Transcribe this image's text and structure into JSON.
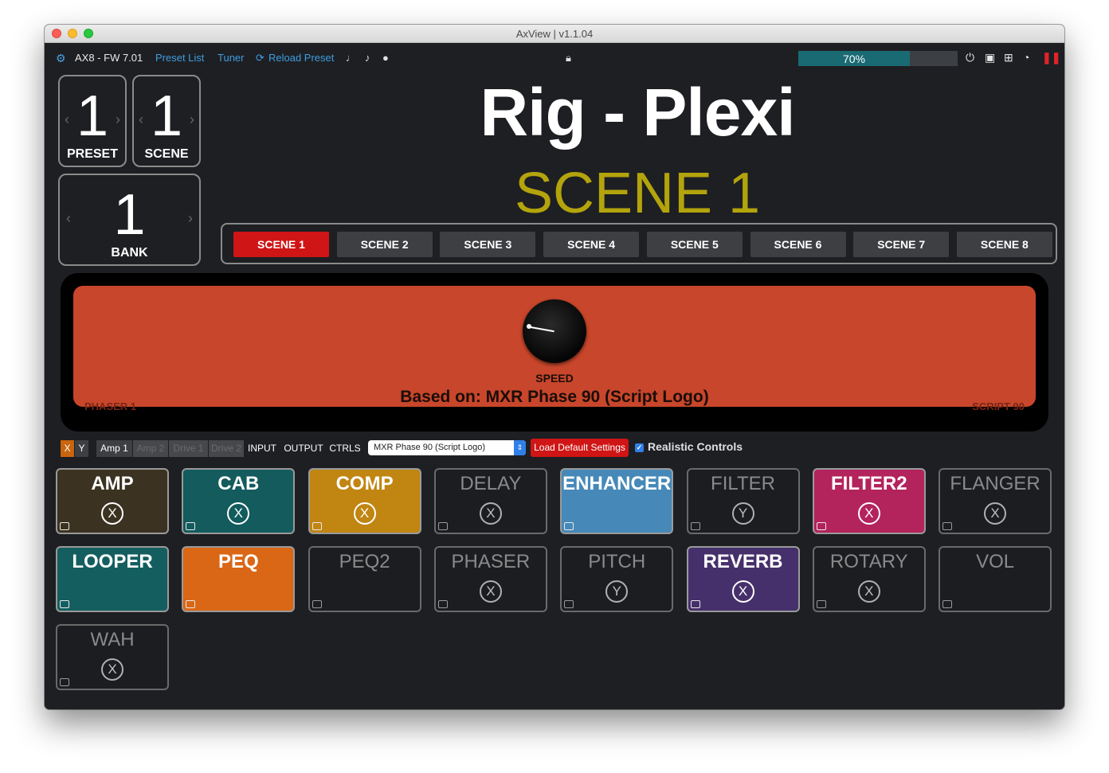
{
  "window": {
    "title": "AxView | v1.1.04"
  },
  "toolbar": {
    "device": "AX8 - FW 7.01",
    "preset_list": "Preset List",
    "tuner": "Tuner",
    "reload": "Reload Preset",
    "progress_label": "70%",
    "progress_value": 0.7
  },
  "counters": {
    "preset": {
      "value": "1",
      "label": "PRESET"
    },
    "scene": {
      "value": "1",
      "label": "SCENE"
    },
    "bank": {
      "value": "1",
      "label": "BANK"
    }
  },
  "rig_name": "Rig - Plexi",
  "scene_name": "SCENE 1",
  "scenes": [
    "SCENE 1",
    "SCENE 2",
    "SCENE 3",
    "SCENE 4",
    "SCENE 5",
    "SCENE 6",
    "SCENE 7",
    "SCENE 8"
  ],
  "active_scene": 0,
  "effect": {
    "knob_label": "SPEED",
    "based_on": "Based on: MXR Phase 90 (Script Logo)",
    "block_name": "PHASER 1",
    "model_name": "SCRIPT 90",
    "color": "#c8462b"
  },
  "controls": {
    "x": "X",
    "y": "Y",
    "tabs": [
      "Amp 1",
      "Amp 2",
      "Drive 1",
      "Drive 2",
      "INPUT",
      "OUTPUT",
      "CTRLS"
    ],
    "dimmed_tabs": [
      1,
      2,
      3
    ],
    "preset_select": "MXR Phase 90 (Script Logo)",
    "load_default": "Load Default Settings",
    "realistic": "Realistic Controls",
    "realistic_checked": true
  },
  "blocks": [
    {
      "name": "AMP",
      "state": "X",
      "on": true,
      "color": "#3b3221"
    },
    {
      "name": "CAB",
      "state": "X",
      "on": true,
      "color": "#135b5d"
    },
    {
      "name": "COMP",
      "state": "X",
      "on": true,
      "color": "#c18512"
    },
    {
      "name": "DELAY",
      "state": "X",
      "on": false,
      "color": ""
    },
    {
      "name": "ENHANCER",
      "state": "",
      "on": true,
      "color": "#4689b8"
    },
    {
      "name": "FILTER",
      "state": "Y",
      "on": false,
      "color": ""
    },
    {
      "name": "FILTER2",
      "state": "X",
      "on": true,
      "color": "#b3235c"
    },
    {
      "name": "FLANGER",
      "state": "X",
      "on": false,
      "color": ""
    },
    {
      "name": "LOOPER",
      "state": "",
      "on": true,
      "color": "#145e60"
    },
    {
      "name": "PEQ",
      "state": "",
      "on": true,
      "color": "#d96716"
    },
    {
      "name": "PEQ2",
      "state": "",
      "on": false,
      "color": ""
    },
    {
      "name": "PHASER",
      "state": "X",
      "on": false,
      "color": ""
    },
    {
      "name": "PITCH",
      "state": "Y",
      "on": false,
      "color": ""
    },
    {
      "name": "REVERB",
      "state": "X",
      "on": true,
      "color": "#46306b"
    },
    {
      "name": "ROTARY",
      "state": "X",
      "on": false,
      "color": ""
    },
    {
      "name": "VOL",
      "state": "",
      "on": false,
      "color": ""
    },
    {
      "name": "WAH",
      "state": "X",
      "on": false,
      "color": ""
    }
  ]
}
